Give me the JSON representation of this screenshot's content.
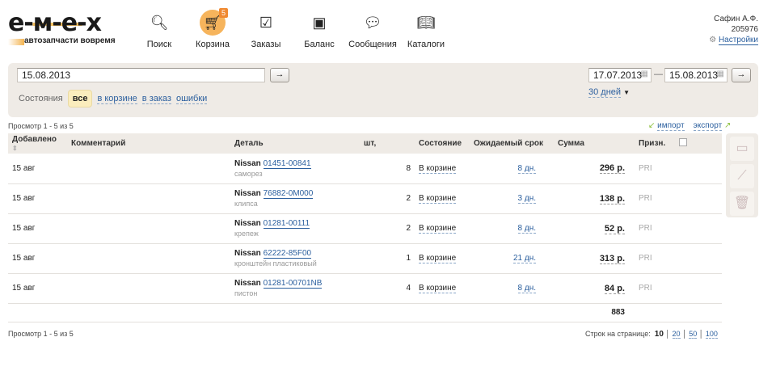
{
  "logo": {
    "text": "e-m-e-x",
    "tagline": "автозапчасти вовремя"
  },
  "nav": [
    {
      "label": "Поиск",
      "icon": "search-icon"
    },
    {
      "label": "Корзина",
      "icon": "cart-icon",
      "badge": "5",
      "active": true
    },
    {
      "label": "Заказы",
      "icon": "orders-icon"
    },
    {
      "label": "Баланс",
      "icon": "wallet-icon"
    },
    {
      "label": "Сообщения",
      "icon": "chat-icon"
    },
    {
      "label": "Каталоги",
      "icon": "book-icon"
    }
  ],
  "user": {
    "name": "Сафин А.Ф.",
    "id": "205976",
    "settings": "Настройки"
  },
  "filter": {
    "search_value": "15.08.2013",
    "go": "→",
    "states_label": "Состояния",
    "states": [
      "все",
      "в корзине",
      "в заказ",
      "ошибки"
    ],
    "date_from": "17.07.2013",
    "date_sep": "—",
    "date_to": "15.08.2013",
    "period": "30 дней"
  },
  "view_info": "Просмотр 1 - 5 из 5",
  "import": "импорт",
  "export": "экспорт",
  "columns": [
    "Добавлено",
    "Комментарий",
    "Деталь",
    "шт,",
    "Состояние",
    "Ожидаемый срок",
    "Сумма",
    "Призн."
  ],
  "rows": [
    {
      "date": "15 авг",
      "brand": "Nissan",
      "part": "01451-00841",
      "desc": "саморез",
      "qty": "8",
      "state": "В корзине",
      "term": "8 дн.",
      "sum": "296 р.",
      "flag": "PRI"
    },
    {
      "date": "15 авг",
      "brand": "Nissan",
      "part": "76882-0M000",
      "desc": "клипса",
      "qty": "2",
      "state": "В корзине",
      "term": "3 дн.",
      "sum": "138 р.",
      "flag": "PRI"
    },
    {
      "date": "15 авг",
      "brand": "Nissan",
      "part": "01281-00111",
      "desc": "крепеж",
      "qty": "2",
      "state": "В корзине",
      "term": "8 дн.",
      "sum": "52 р.",
      "flag": "PRI"
    },
    {
      "date": "15 авг",
      "brand": "Nissan",
      "part": "62222-85F00",
      "desc": "кронштейн пластиковый",
      "qty": "1",
      "state": "В корзине",
      "term": "21 дн.",
      "sum": "313 р.",
      "flag": "PRI"
    },
    {
      "date": "15 авг",
      "brand": "Nissan",
      "part": "01281-00701NB",
      "desc": "пистон",
      "qty": "4",
      "state": "В корзине",
      "term": "8 дн.",
      "sum": "84 р.",
      "flag": "PRI"
    }
  ],
  "total": "883",
  "pager": {
    "label": "Строк на странице:",
    "options": [
      "10",
      "20",
      "50",
      "100"
    ],
    "current": "10"
  }
}
